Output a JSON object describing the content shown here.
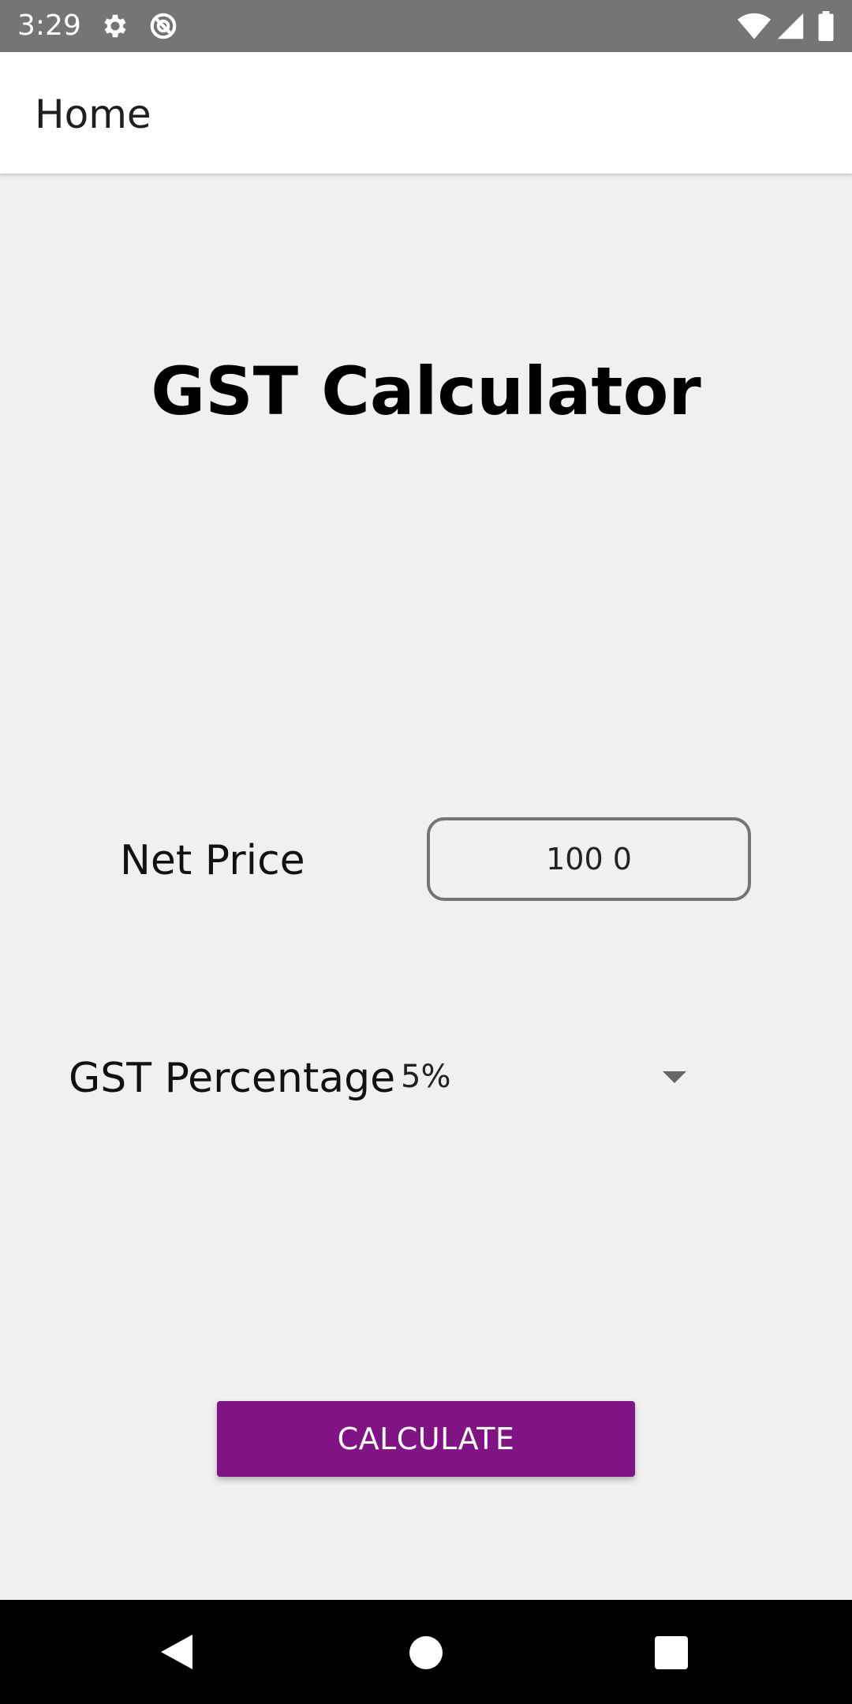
{
  "status_bar": {
    "time": "3:29",
    "left_icons": [
      "settings-gear-icon",
      "do-not-disturb-icon"
    ],
    "right_icons": [
      "wifi-icon",
      "cellular-signal-icon",
      "battery-icon"
    ]
  },
  "app_bar": {
    "title": "Home"
  },
  "main": {
    "title": "GST Calculator",
    "net_price": {
      "label": "Net Price",
      "value": "100 0"
    },
    "gst_percentage": {
      "label": "GST Percentage",
      "selected": "5%"
    },
    "calculate_button": {
      "label": "CALCULATE",
      "color": "#811484"
    }
  },
  "nav_bar": {
    "buttons": [
      "back-icon",
      "home-icon",
      "recents-icon"
    ]
  }
}
